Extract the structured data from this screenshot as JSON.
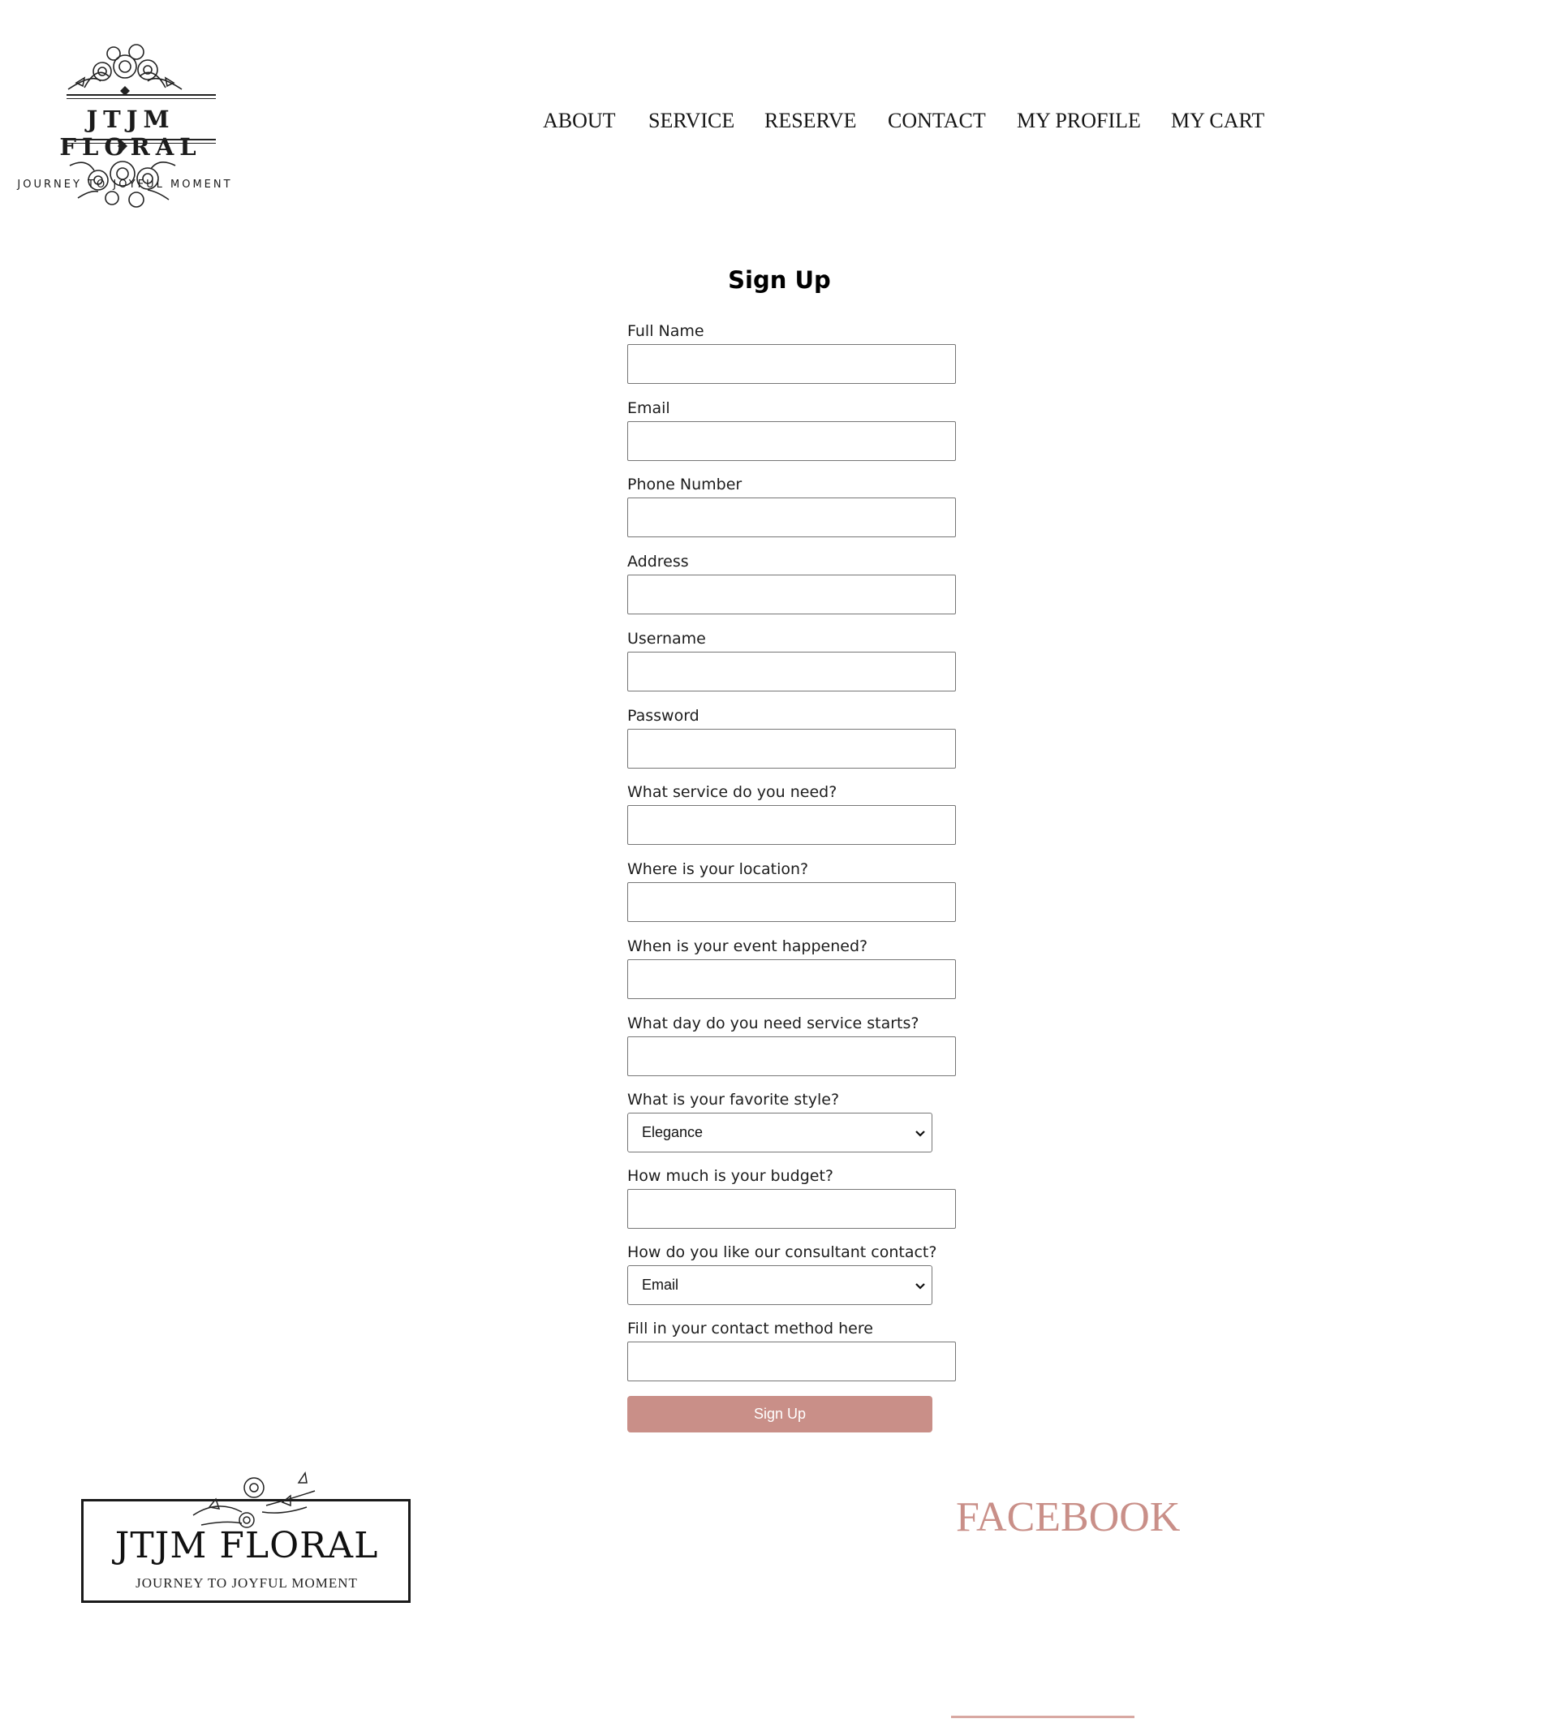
{
  "header": {
    "logo": {
      "brand": "JTJM FLORAL",
      "tagline": "JOURNEY TO JOYFUL MOMENT"
    },
    "nav": [
      "ABOUT",
      "SERVICE",
      "RESERVE",
      "CONTACT",
      "MY PROFILE",
      "MY CART"
    ]
  },
  "form": {
    "title": "Sign Up",
    "fields": [
      {
        "label": "Full Name",
        "value": ""
      },
      {
        "label": "Email",
        "value": ""
      },
      {
        "label": "Phone Number",
        "value": ""
      },
      {
        "label": "Address",
        "value": ""
      },
      {
        "label": "Username",
        "value": ""
      },
      {
        "label": "Password",
        "value": ""
      },
      {
        "label": "What service do you need?",
        "value": ""
      },
      {
        "label": "Where is your location?",
        "value": ""
      },
      {
        "label": "When is your event happened?",
        "value": ""
      },
      {
        "label": "What day do you need service starts?",
        "value": ""
      },
      {
        "label": "What is your favorite style?",
        "selected": "Elegance"
      },
      {
        "label": "How much is your budget?",
        "value": ""
      },
      {
        "label": "How do you like our consultant contact?",
        "selected": "Email"
      },
      {
        "label": "Fill in your contact method here",
        "value": ""
      }
    ],
    "submit_label": "Sign Up"
  },
  "footer": {
    "logo": {
      "brand": "JTJM FLORAL",
      "tagline": "JOURNEY TO JOYFUL MOMENT"
    },
    "social_link": "FACEBOOK"
  },
  "colors": {
    "accent": "#c98f88",
    "text": "#161616",
    "background": "#ffffff"
  },
  "icons": [
    "floral-ornament-icon",
    "chevron-down-icon"
  ]
}
